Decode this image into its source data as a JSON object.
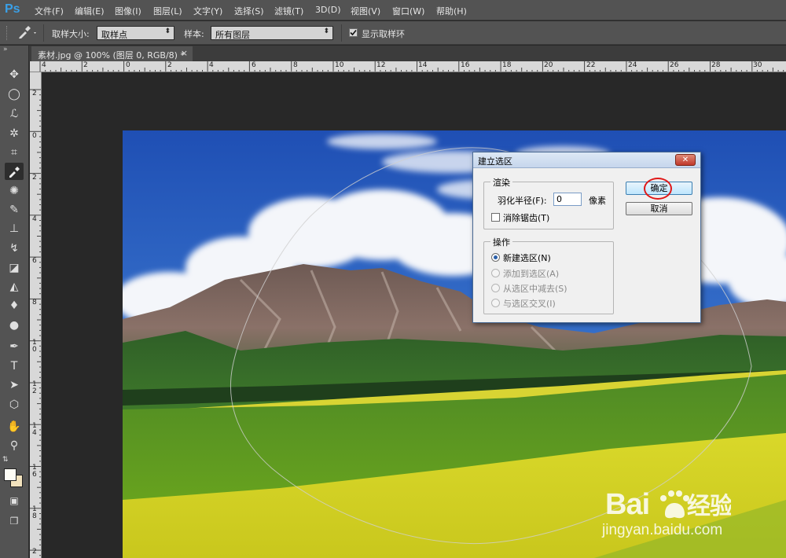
{
  "app": {
    "logo": "Ps"
  },
  "menu": [
    "文件(F)",
    "编辑(E)",
    "图像(I)",
    "图层(L)",
    "文字(Y)",
    "选择(S)",
    "滤镜(T)",
    "3D(D)",
    "视图(V)",
    "窗口(W)",
    "帮助(H)"
  ],
  "options": {
    "sample_size_label": "取样大小:",
    "sample_size_value": "取样点",
    "sample_label": "样本:",
    "sample_value": "所有图层",
    "show_ring_label": "显示取样环"
  },
  "document_tab": {
    "title": "素材.jpg @ 100% (图层 0, RGB/8) *",
    "close": "×"
  },
  "ruler": {
    "horizontal": [
      "4",
      "2",
      "0",
      "2",
      "4",
      "6",
      "8",
      "10",
      "12",
      "14",
      "16",
      "18",
      "20",
      "22",
      "24",
      "26",
      "28",
      "30"
    ],
    "vertical": [
      "2",
      "0",
      "2",
      "4",
      "6",
      "8",
      "1 0",
      "1 2",
      "1 4",
      "1 6",
      "1 8",
      "2"
    ]
  },
  "dialog": {
    "title": "建立选区",
    "close": "✕",
    "render_group": "渲染",
    "feather_label": "羽化半径(F):",
    "feather_value": "0",
    "feather_unit": "像素",
    "antialias_label": "消除锯齿(T)",
    "operation_group": "操作",
    "op_new": "新建选区(N)",
    "op_add": "添加到选区(A)",
    "op_subtract": "从选区中减去(S)",
    "op_intersect": "与选区交叉(I)",
    "ok": "确定",
    "cancel": "取消"
  },
  "watermark": {
    "logo": "Bai du 经验",
    "url": "jingyan.baidu.com"
  },
  "colors": {
    "accent": "#3aa0e8",
    "highlight": "#e01818",
    "ui_bg": "#535353",
    "canvas_bg": "#282828"
  }
}
